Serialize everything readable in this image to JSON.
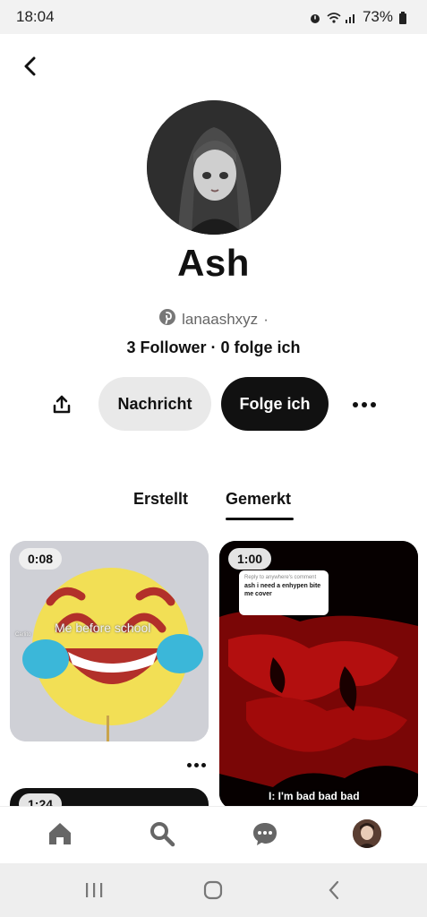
{
  "status_bar": {
    "time": "18:04",
    "battery": "73%"
  },
  "profile": {
    "name": "Ash",
    "username": "lanaashxyz",
    "username_separator": "·",
    "followers_text": "3 Follower · 0 folge ich"
  },
  "actions": {
    "message_label": "Nachricht",
    "follow_label": "Folge ich"
  },
  "tabs": [
    {
      "label": "Erstellt",
      "active": false
    },
    {
      "label": "Gemerkt",
      "active": true
    }
  ],
  "pins": [
    {
      "duration": "0:08",
      "overlay_text": "Me before school",
      "small_label": "Carlito"
    },
    {
      "duration": "1:00",
      "comment_title": "Reply to anywhere's comment",
      "comment_text": "ash i need a enhypen bite me cover",
      "caption": "I: I'm bad bad bad"
    },
    {
      "duration": "1:24"
    }
  ],
  "icons": {
    "back": "chevron-left-icon",
    "share": "share-icon",
    "more": "more-horizontal-icon",
    "pinterest": "pinterest-logo-icon",
    "home": "home-icon",
    "search": "search-icon",
    "messages": "chat-bubble-icon"
  },
  "colors": {
    "primary_button_bg": "#111111",
    "secondary_button_bg": "#e9e9e9",
    "pin2_red": "#a30c0c",
    "emoji_yellow": "#f2df55"
  }
}
